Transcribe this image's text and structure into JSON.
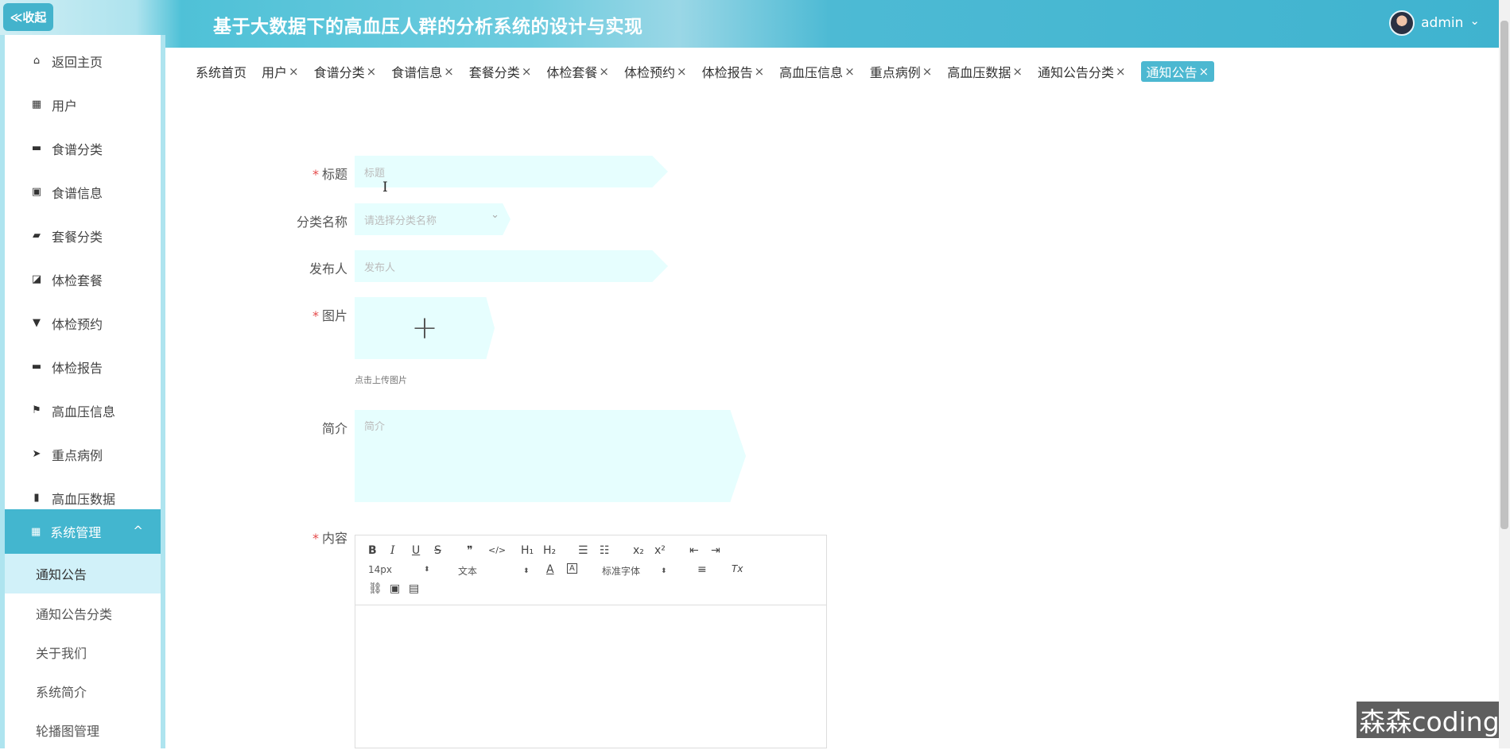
{
  "header": {
    "title": "基于大数据下的高血压人群的分析系统的设计与实现",
    "collapse_label": "≪收起",
    "user_name": "admin",
    "user_caret": "⌄"
  },
  "sidebar": {
    "items": [
      {
        "label": "返回主页",
        "icon": "home-icon",
        "glyph": "⌂"
      },
      {
        "label": "用户",
        "icon": "grid-icon",
        "glyph": "▦"
      },
      {
        "label": "食谱分类",
        "icon": "bookmark-icon",
        "glyph": "▬"
      },
      {
        "label": "食谱信息",
        "icon": "clipboard-icon",
        "glyph": "▣"
      },
      {
        "label": "套餐分类",
        "icon": "ticket-icon",
        "glyph": "▰"
      },
      {
        "label": "体检套餐",
        "icon": "chart-icon",
        "glyph": "◪"
      },
      {
        "label": "体检预约",
        "icon": "stamp-icon",
        "glyph": "▼"
      },
      {
        "label": "体检报告",
        "icon": "briefcase-icon",
        "glyph": "▬"
      },
      {
        "label": "高血压信息",
        "icon": "flag-icon",
        "glyph": "⚑"
      },
      {
        "label": "重点病例",
        "icon": "send-icon",
        "glyph": "➤"
      },
      {
        "label": "高血压数据",
        "icon": "bar-chart-icon",
        "glyph": "▮"
      }
    ],
    "group": {
      "label": "系统管理",
      "icon": "grid-icon",
      "glyph": "▦",
      "chevron": "^"
    },
    "sub_items": [
      "通知公告",
      "通知公告分类",
      "关于我们",
      "系统简介",
      "轮播图管理"
    ]
  },
  "tabs": [
    {
      "label": "系统首页",
      "closable": false
    },
    {
      "label": "用户",
      "closable": true
    },
    {
      "label": "食谱分类",
      "closable": true
    },
    {
      "label": "食谱信息",
      "closable": true
    },
    {
      "label": "套餐分类",
      "closable": true
    },
    {
      "label": "体检套餐",
      "closable": true
    },
    {
      "label": "体检预约",
      "closable": true
    },
    {
      "label": "体检报告",
      "closable": true
    },
    {
      "label": "高血压信息",
      "closable": true
    },
    {
      "label": "重点病例",
      "closable": true
    },
    {
      "label": "高血压数据",
      "closable": true
    },
    {
      "label": "通知公告分类",
      "closable": true
    },
    {
      "label": "通知公告",
      "closable": true,
      "active": true
    }
  ],
  "tab_close": "×",
  "form": {
    "title_label": "标题",
    "title_placeholder": "标题",
    "category_label": "分类名称",
    "category_placeholder": "请选择分类名称",
    "category_caret": "⌄",
    "publisher_label": "发布人",
    "publisher_placeholder": "发布人",
    "image_label": "图片",
    "upload_plus": "+",
    "upload_hint": "点击上传图片",
    "intro_label": "简介",
    "intro_placeholder": "简介",
    "content_label": "内容",
    "required_mark": "*"
  },
  "editor": {
    "font_size": "14px",
    "header_select": "文本",
    "font_family": "标准字体",
    "select_arrow": "⬍",
    "buttons": {
      "bold": "B",
      "italic": "I",
      "underline": "U",
      "strike": "S",
      "blockquote": "❞",
      "code": "</>",
      "h1": "H₁",
      "h2": "H₂",
      "ordered_list": "☰",
      "bullet_list": "☷",
      "subscript": "x₂",
      "superscript": "x²",
      "outdent": "⇤",
      "indent": "⇥",
      "color": "A",
      "background": "A",
      "align": "≡",
      "clean": "Tx",
      "link": "⛓",
      "image": "▣",
      "video": "▤"
    }
  },
  "watermark": "森森coding",
  "colors": {
    "accent": "#43b6cf",
    "field_bg": "#e6fefe",
    "required": "#e64b4b"
  }
}
